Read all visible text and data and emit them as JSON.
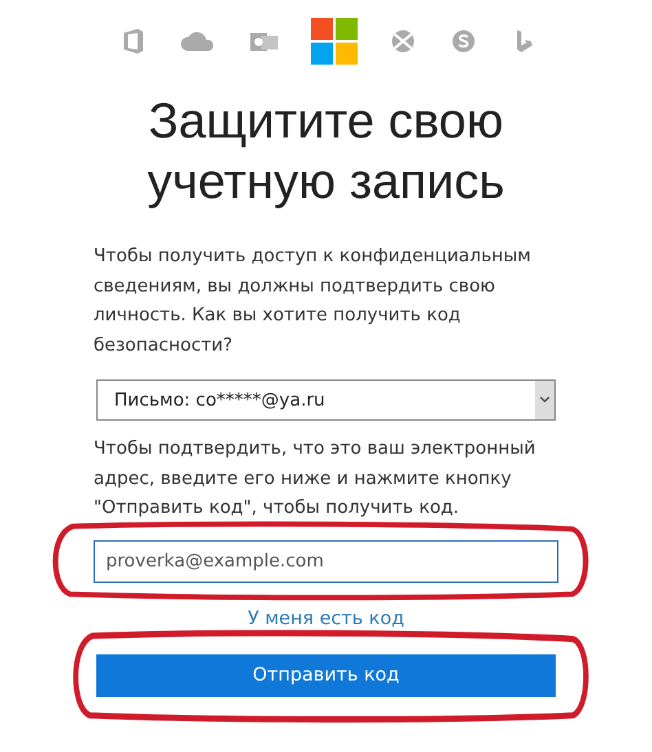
{
  "product_icons": [
    {
      "kind": "office"
    },
    {
      "kind": "onedrive"
    },
    {
      "kind": "outlook"
    },
    {
      "kind": "microsoft"
    },
    {
      "kind": "xbox"
    },
    {
      "kind": "skype"
    },
    {
      "kind": "bing"
    }
  ],
  "title": "Защитите свою учетную запись",
  "intro": "Чтобы получить доступ к конфиденциальным сведениям, вы должны подтвердить свою личность. Как вы хотите получить код безопасности?",
  "method_select": {
    "value": "Письмо: co*****@ya.ru"
  },
  "instructions": "Чтобы подтвердить, что это ваш электронный адрес, введите его ниже и нажмите кнопку \"Отправить код\", чтобы получить код.",
  "email_field": {
    "value": "proverka@example.com",
    "highlighted": true
  },
  "have_code_link": "У меня есть код",
  "send_button": {
    "label": "Отправить код",
    "highlighted": true
  }
}
